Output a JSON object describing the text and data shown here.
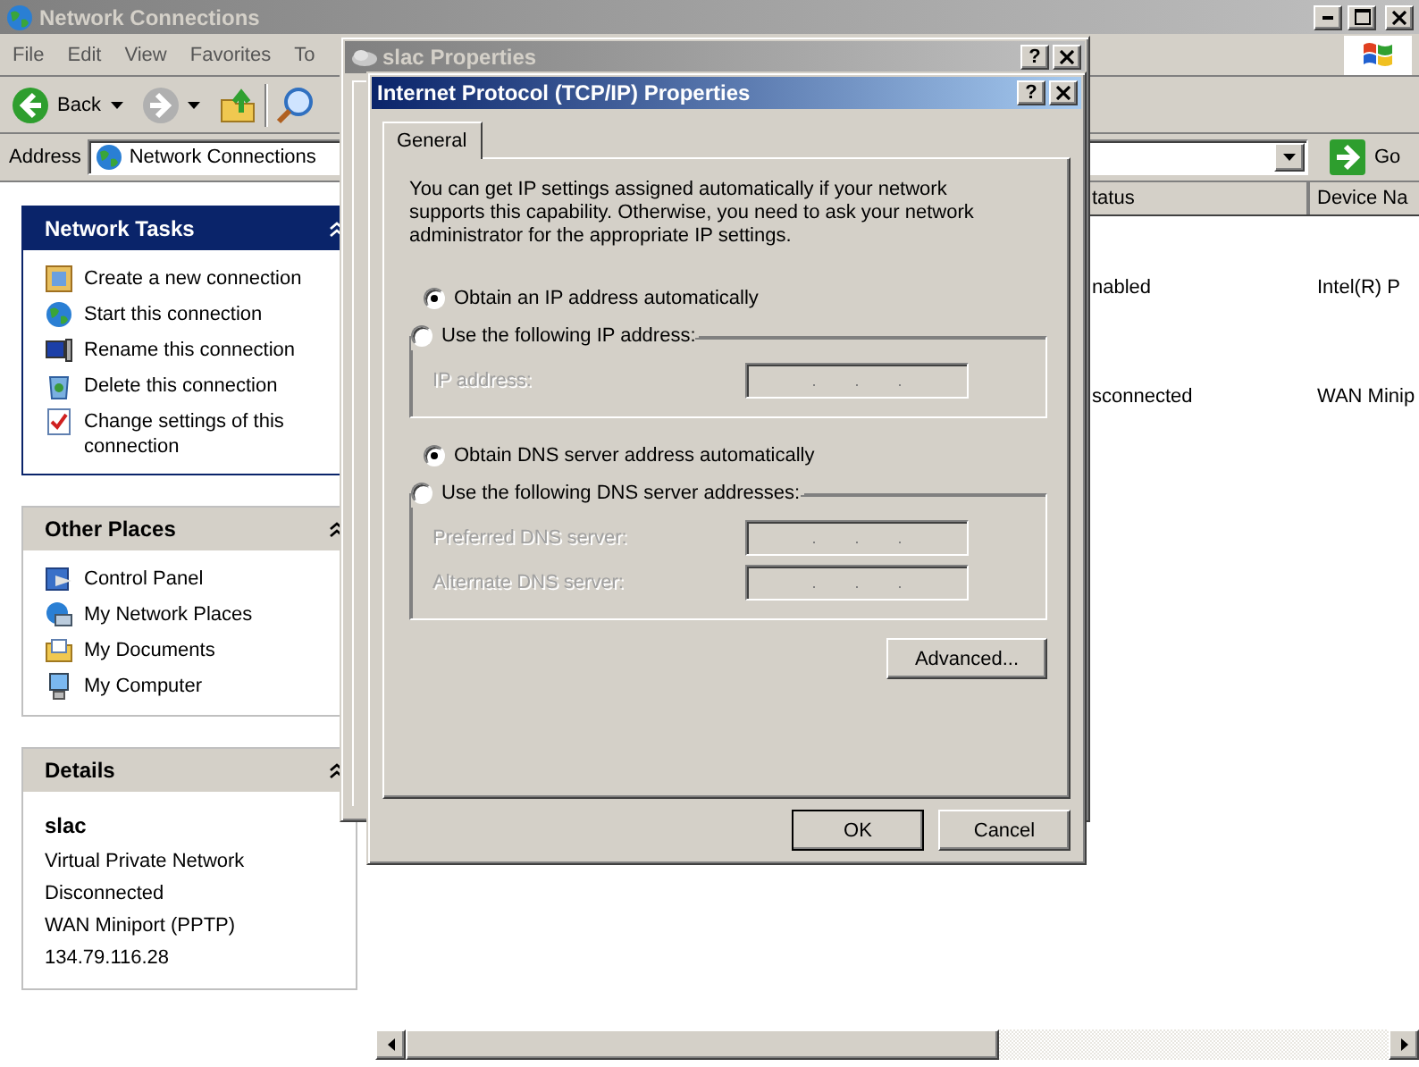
{
  "explorer": {
    "title": "Network Connections",
    "menu": [
      "File",
      "Edit",
      "View",
      "Favorites",
      "To"
    ],
    "back_label": "Back",
    "address_label": "Address",
    "address_value": "Network Connections",
    "go_label": "Go",
    "panels": [
      {
        "title": "Network Tasks",
        "highlighted": true,
        "items": [
          "Create a new connection",
          "Start this connection",
          "Rename this connection",
          "Delete this connection",
          "Change settings of this connection"
        ]
      },
      {
        "title": "Other Places",
        "highlighted": false,
        "items": [
          "Control Panel",
          "My Network Places",
          "My Documents",
          "My Computer"
        ]
      }
    ],
    "details": {
      "title": "Details",
      "name": "slac",
      "lines": [
        "Virtual Private Network",
        "Disconnected",
        "WAN Miniport (PPTP)",
        "134.79.116.28"
      ]
    },
    "columns": [
      "tatus",
      "Device Na"
    ],
    "rows": [
      [
        "nabled",
        "Intel(R) P"
      ],
      [
        "sconnected",
        "WAN Minip"
      ]
    ]
  },
  "background_dialog": {
    "title": "slac Properties",
    "help": "?"
  },
  "dialog": {
    "title": "Internet Protocol (TCP/IP) Properties",
    "help": "?",
    "tabs": [
      {
        "label": "General",
        "selected": true
      }
    ],
    "intro": "You can get IP settings assigned automatically if your network supports this capability. Otherwise, you need to ask your network administrator for the appropriate IP settings.",
    "ip_options": [
      {
        "label": "Obtain an IP address automatically",
        "selected": true
      },
      {
        "label": "Use the following IP address:",
        "selected": false
      }
    ],
    "ip_fields": [
      {
        "label": "IP address:",
        "disabled": true
      }
    ],
    "dns_options": [
      {
        "label": "Obtain DNS server address automatically",
        "selected": true
      },
      {
        "label": "Use the following DNS server addresses:",
        "selected": false
      }
    ],
    "dns_fields": [
      {
        "label": "Preferred DNS server:",
        "disabled": true
      },
      {
        "label": "Alternate DNS server:",
        "disabled": true
      }
    ],
    "advanced": "Advanced...",
    "buttons": [
      "OK",
      "Cancel"
    ]
  }
}
